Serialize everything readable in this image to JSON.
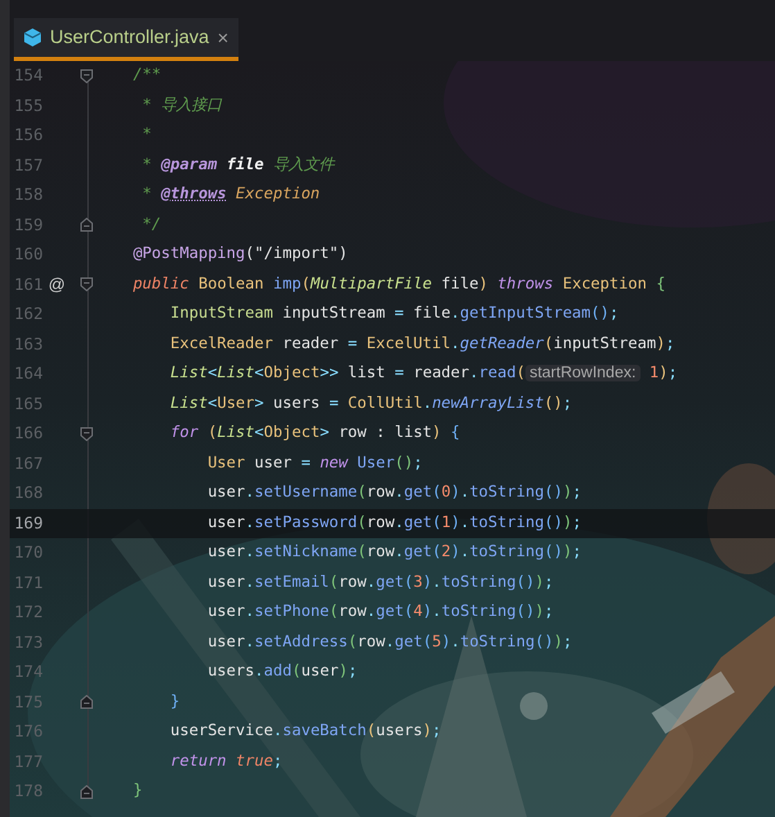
{
  "tab": {
    "title": "UserController.java",
    "close": "×",
    "selected": true
  },
  "lines": [
    {
      "number": "154",
      "fold_start": true,
      "fold_end": false,
      "current": false,
      "tokens": [
        {
          "text": "    /**",
          "kind": "comment"
        }
      ]
    },
    {
      "number": "155",
      "fold_start": false,
      "fold_end": false,
      "current": false,
      "tokens": [
        {
          "text": "     * 导入接口",
          "kind": "comment"
        }
      ]
    },
    {
      "number": "156",
      "fold_start": false,
      "fold_end": false,
      "current": false,
      "tokens": [
        {
          "text": "     *",
          "kind": "comment"
        }
      ]
    },
    {
      "number": "157",
      "fold_start": false,
      "fold_end": false,
      "current": false,
      "tokens": [
        {
          "text": "     * ",
          "kind": "comment"
        },
        {
          "text": "@param",
          "kind": "doctag"
        },
        {
          "text": " file",
          "kind": "docparam"
        },
        {
          "text": " 导入文件",
          "kind": "comment"
        }
      ]
    },
    {
      "number": "158",
      "fold_start": false,
      "fold_end": false,
      "current": false,
      "tokens": [
        {
          "text": "     * ",
          "kind": "comment"
        },
        {
          "text": "@throws",
          "kind": "doctag2"
        },
        {
          "text": " Exception",
          "kind": "doctype"
        }
      ]
    },
    {
      "number": "159",
      "fold_start": false,
      "fold_end": true,
      "current": false,
      "tokens": [
        {
          "text": "     */",
          "kind": "comment"
        }
      ]
    },
    {
      "number": "160",
      "fold_start": false,
      "fold_end": false,
      "current": false,
      "tokens": [
        {
          "text": "    @PostMapping",
          "kind": "annotation"
        },
        {
          "text": "(\"/import\")",
          "kind": "plain"
        }
      ]
    },
    {
      "number": "161",
      "fold_start": true,
      "fold_end": false,
      "current": false,
      "gutter": "@",
      "tokens": [
        {
          "text": "    public",
          "kind": "kwmod"
        },
        {
          "text": " Boolean",
          "kind": "type"
        },
        {
          "text": " imp",
          "kind": "method"
        },
        {
          "text": "(",
          "kind": "p1"
        },
        {
          "text": "MultipartFile",
          "kind": "itype"
        },
        {
          "text": " file",
          "kind": "plain"
        },
        {
          "text": ")",
          "kind": "p1"
        },
        {
          "text": " throws",
          "kind": "kw"
        },
        {
          "text": " Exception",
          "kind": "type"
        },
        {
          "text": " {",
          "kind": "p2"
        }
      ]
    },
    {
      "number": "162",
      "fold_start": false,
      "fold_end": false,
      "current": false,
      "tokens": [
        {
          "text": "        InputStream",
          "kind": "type2"
        },
        {
          "text": " inputStream ",
          "kind": "plain"
        },
        {
          "text": "=",
          "kind": "punct"
        },
        {
          "text": " file",
          "kind": "plain"
        },
        {
          "text": ".",
          "kind": "punct"
        },
        {
          "text": "getInputStream",
          "kind": "method"
        },
        {
          "text": "()",
          "kind": "p3"
        },
        {
          "text": ";",
          "kind": "punct"
        }
      ]
    },
    {
      "number": "163",
      "fold_start": false,
      "fold_end": false,
      "current": false,
      "tokens": [
        {
          "text": "        ExcelReader",
          "kind": "type"
        },
        {
          "text": " reader ",
          "kind": "plain"
        },
        {
          "text": "=",
          "kind": "punct"
        },
        {
          "text": " ExcelUtil",
          "kind": "type"
        },
        {
          "text": ".",
          "kind": "punct"
        },
        {
          "text": "getReader",
          "kind": "smethod"
        },
        {
          "text": "(",
          "kind": "p1"
        },
        {
          "text": "inputStream",
          "kind": "plain"
        },
        {
          "text": ")",
          "kind": "p1"
        },
        {
          "text": ";",
          "kind": "punct"
        }
      ]
    },
    {
      "number": "164",
      "fold_start": false,
      "fold_end": false,
      "current": false,
      "tokens": [
        {
          "text": "        List",
          "kind": "itype"
        },
        {
          "text": "<",
          "kind": "punct"
        },
        {
          "text": "List",
          "kind": "itype"
        },
        {
          "text": "<",
          "kind": "punct"
        },
        {
          "text": "Object",
          "kind": "type"
        },
        {
          "text": ">>",
          "kind": "punct"
        },
        {
          "text": " list ",
          "kind": "plain"
        },
        {
          "text": "=",
          "kind": "punct"
        },
        {
          "text": " reader",
          "kind": "plain"
        },
        {
          "text": ".",
          "kind": "punct"
        },
        {
          "text": "read",
          "kind": "method"
        },
        {
          "text": "(",
          "kind": "p1"
        },
        {
          "text": "startRowIndex:",
          "kind": "hint"
        },
        {
          "text": " 1",
          "kind": "number"
        },
        {
          "text": ")",
          "kind": "p1"
        },
        {
          "text": ";",
          "kind": "punct"
        }
      ]
    },
    {
      "number": "165",
      "fold_start": false,
      "fold_end": false,
      "current": false,
      "tokens": [
        {
          "text": "        List",
          "kind": "itype"
        },
        {
          "text": "<",
          "kind": "punct"
        },
        {
          "text": "User",
          "kind": "type"
        },
        {
          "text": ">",
          "kind": "punct"
        },
        {
          "text": " users ",
          "kind": "plain"
        },
        {
          "text": "=",
          "kind": "punct"
        },
        {
          "text": " CollUtil",
          "kind": "type"
        },
        {
          "text": ".",
          "kind": "punct"
        },
        {
          "text": "newArrayList",
          "kind": "smethod"
        },
        {
          "text": "()",
          "kind": "p1"
        },
        {
          "text": ";",
          "kind": "punct"
        }
      ]
    },
    {
      "number": "166",
      "fold_start": true,
      "fold_end": false,
      "current": false,
      "tokens": [
        {
          "text": "        for",
          "kind": "kw"
        },
        {
          "text": " (",
          "kind": "p1"
        },
        {
          "text": "List",
          "kind": "itype"
        },
        {
          "text": "<",
          "kind": "punct"
        },
        {
          "text": "Object",
          "kind": "type"
        },
        {
          "text": ">",
          "kind": "punct"
        },
        {
          "text": " row : list",
          "kind": "plain"
        },
        {
          "text": ")",
          "kind": "p1"
        },
        {
          "text": " {",
          "kind": "p3"
        }
      ]
    },
    {
      "number": "167",
      "fold_start": false,
      "fold_end": false,
      "current": false,
      "tokens": [
        {
          "text": "            User",
          "kind": "type"
        },
        {
          "text": " user ",
          "kind": "plain"
        },
        {
          "text": "=",
          "kind": "punct"
        },
        {
          "text": " new",
          "kind": "kw"
        },
        {
          "text": " User",
          "kind": "method"
        },
        {
          "text": "()",
          "kind": "p2"
        },
        {
          "text": ";",
          "kind": "punct"
        }
      ]
    },
    {
      "number": "168",
      "fold_start": false,
      "fold_end": false,
      "current": false,
      "tokens": [
        {
          "text": "            user",
          "kind": "plain"
        },
        {
          "text": ".",
          "kind": "punct"
        },
        {
          "text": "setUsername",
          "kind": "method"
        },
        {
          "text": "(",
          "kind": "p2"
        },
        {
          "text": "row",
          "kind": "plain"
        },
        {
          "text": ".",
          "kind": "punct"
        },
        {
          "text": "get",
          "kind": "method"
        },
        {
          "text": "(",
          "kind": "p3"
        },
        {
          "text": "0",
          "kind": "number"
        },
        {
          "text": ")",
          "kind": "p3"
        },
        {
          "text": ".",
          "kind": "punct"
        },
        {
          "text": "toString",
          "kind": "method"
        },
        {
          "text": "()",
          "kind": "p3"
        },
        {
          "text": ")",
          "kind": "p2"
        },
        {
          "text": ";",
          "kind": "punct"
        }
      ]
    },
    {
      "number": "169",
      "fold_start": false,
      "fold_end": false,
      "current": true,
      "tokens": [
        {
          "text": "            user",
          "kind": "plain"
        },
        {
          "text": ".",
          "kind": "punct"
        },
        {
          "text": "setPassword",
          "kind": "method"
        },
        {
          "text": "(",
          "kind": "p2"
        },
        {
          "text": "row",
          "kind": "plain"
        },
        {
          "text": ".",
          "kind": "punct"
        },
        {
          "text": "get",
          "kind": "method"
        },
        {
          "text": "(",
          "kind": "p3"
        },
        {
          "text": "1",
          "kind": "number"
        },
        {
          "text": ")",
          "kind": "p3"
        },
        {
          "text": ".",
          "kind": "punct"
        },
        {
          "text": "toString",
          "kind": "method"
        },
        {
          "text": "()",
          "kind": "p3"
        },
        {
          "text": ")",
          "kind": "p2"
        },
        {
          "text": ";",
          "kind": "punct"
        }
      ]
    },
    {
      "number": "170",
      "fold_start": false,
      "fold_end": false,
      "current": false,
      "tokens": [
        {
          "text": "            user",
          "kind": "plain"
        },
        {
          "text": ".",
          "kind": "punct"
        },
        {
          "text": "setNickname",
          "kind": "method"
        },
        {
          "text": "(",
          "kind": "p2"
        },
        {
          "text": "row",
          "kind": "plain"
        },
        {
          "text": ".",
          "kind": "punct"
        },
        {
          "text": "get",
          "kind": "method"
        },
        {
          "text": "(",
          "kind": "p3"
        },
        {
          "text": "2",
          "kind": "number"
        },
        {
          "text": ")",
          "kind": "p3"
        },
        {
          "text": ".",
          "kind": "punct"
        },
        {
          "text": "toString",
          "kind": "method"
        },
        {
          "text": "()",
          "kind": "p3"
        },
        {
          "text": ")",
          "kind": "p2"
        },
        {
          "text": ";",
          "kind": "punct"
        }
      ]
    },
    {
      "number": "171",
      "fold_start": false,
      "fold_end": false,
      "current": false,
      "tokens": [
        {
          "text": "            user",
          "kind": "plain"
        },
        {
          "text": ".",
          "kind": "punct"
        },
        {
          "text": "setEmail",
          "kind": "method"
        },
        {
          "text": "(",
          "kind": "p2"
        },
        {
          "text": "row",
          "kind": "plain"
        },
        {
          "text": ".",
          "kind": "punct"
        },
        {
          "text": "get",
          "kind": "method"
        },
        {
          "text": "(",
          "kind": "p3"
        },
        {
          "text": "3",
          "kind": "number"
        },
        {
          "text": ")",
          "kind": "p3"
        },
        {
          "text": ".",
          "kind": "punct"
        },
        {
          "text": "toString",
          "kind": "method"
        },
        {
          "text": "()",
          "kind": "p3"
        },
        {
          "text": ")",
          "kind": "p2"
        },
        {
          "text": ";",
          "kind": "punct"
        }
      ]
    },
    {
      "number": "172",
      "fold_start": false,
      "fold_end": false,
      "current": false,
      "tokens": [
        {
          "text": "            user",
          "kind": "plain"
        },
        {
          "text": ".",
          "kind": "punct"
        },
        {
          "text": "setPhone",
          "kind": "method"
        },
        {
          "text": "(",
          "kind": "p2"
        },
        {
          "text": "row",
          "kind": "plain"
        },
        {
          "text": ".",
          "kind": "punct"
        },
        {
          "text": "get",
          "kind": "method"
        },
        {
          "text": "(",
          "kind": "p3"
        },
        {
          "text": "4",
          "kind": "number"
        },
        {
          "text": ")",
          "kind": "p3"
        },
        {
          "text": ".",
          "kind": "punct"
        },
        {
          "text": "toString",
          "kind": "method"
        },
        {
          "text": "()",
          "kind": "p3"
        },
        {
          "text": ")",
          "kind": "p2"
        },
        {
          "text": ";",
          "kind": "punct"
        }
      ]
    },
    {
      "number": "173",
      "fold_start": false,
      "fold_end": false,
      "current": false,
      "tokens": [
        {
          "text": "            user",
          "kind": "plain"
        },
        {
          "text": ".",
          "kind": "punct"
        },
        {
          "text": "setAddress",
          "kind": "method"
        },
        {
          "text": "(",
          "kind": "p2"
        },
        {
          "text": "row",
          "kind": "plain"
        },
        {
          "text": ".",
          "kind": "punct"
        },
        {
          "text": "get",
          "kind": "method"
        },
        {
          "text": "(",
          "kind": "p3"
        },
        {
          "text": "5",
          "kind": "number"
        },
        {
          "text": ")",
          "kind": "p3"
        },
        {
          "text": ".",
          "kind": "punct"
        },
        {
          "text": "toString",
          "kind": "method"
        },
        {
          "text": "()",
          "kind": "p3"
        },
        {
          "text": ")",
          "kind": "p2"
        },
        {
          "text": ";",
          "kind": "punct"
        }
      ]
    },
    {
      "number": "174",
      "fold_start": false,
      "fold_end": false,
      "current": false,
      "tokens": [
        {
          "text": "            users",
          "kind": "plain"
        },
        {
          "text": ".",
          "kind": "punct"
        },
        {
          "text": "add",
          "kind": "method"
        },
        {
          "text": "(",
          "kind": "p2"
        },
        {
          "text": "user",
          "kind": "plain"
        },
        {
          "text": ")",
          "kind": "p2"
        },
        {
          "text": ";",
          "kind": "punct"
        }
      ]
    },
    {
      "number": "175",
      "fold_start": false,
      "fold_end": true,
      "current": false,
      "tokens": [
        {
          "text": "        }",
          "kind": "p3"
        }
      ]
    },
    {
      "number": "176",
      "fold_start": false,
      "fold_end": false,
      "current": false,
      "tokens": [
        {
          "text": "        userService",
          "kind": "plain"
        },
        {
          "text": ".",
          "kind": "punct"
        },
        {
          "text": "saveBatch",
          "kind": "method"
        },
        {
          "text": "(",
          "kind": "p1"
        },
        {
          "text": "users",
          "kind": "plain"
        },
        {
          "text": ")",
          "kind": "p1"
        },
        {
          "text": ";",
          "kind": "punct"
        }
      ]
    },
    {
      "number": "177",
      "fold_start": false,
      "fold_end": false,
      "current": false,
      "tokens": [
        {
          "text": "        return",
          "kind": "kw"
        },
        {
          "text": " true",
          "kind": "kwmod"
        },
        {
          "text": ";",
          "kind": "punct"
        }
      ]
    },
    {
      "number": "178",
      "fold_start": false,
      "fold_end": true,
      "current": false,
      "tokens": [
        {
          "text": "    }",
          "kind": "p2"
        }
      ]
    }
  ]
}
